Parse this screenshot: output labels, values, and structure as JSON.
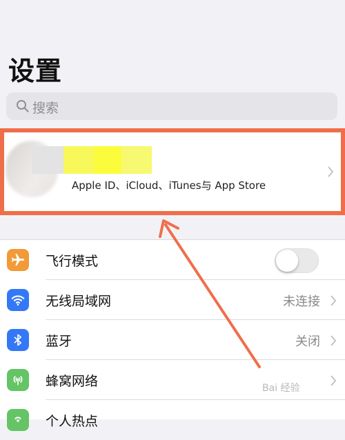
{
  "page": {
    "title": "设置"
  },
  "search": {
    "placeholder": "搜索"
  },
  "profile": {
    "subtitle": "Apple ID、iCloud、iTunes与 App Store"
  },
  "settings": [
    {
      "label": "飞行模式",
      "icon": "airplane-icon",
      "icon_color": "#f19a37",
      "control": "toggle",
      "toggle_on": false
    },
    {
      "label": "无线局域网",
      "icon": "wifi-icon",
      "icon_color": "#3478f6",
      "value": "未连接"
    },
    {
      "label": "蓝牙",
      "icon": "bluetooth-icon",
      "icon_color": "#3478f6",
      "value": "关闭"
    },
    {
      "label": "蜂窝网络",
      "icon": "cellular-icon",
      "icon_color": "#65c466"
    },
    {
      "label": "个人热点",
      "icon": "hotspot-icon",
      "icon_color": "#65c466"
    }
  ],
  "watermark": {
    "text": "Bai 经验"
  },
  "colors": {
    "highlight": "#ef6e4a",
    "arrow": "#ef6e4a"
  }
}
